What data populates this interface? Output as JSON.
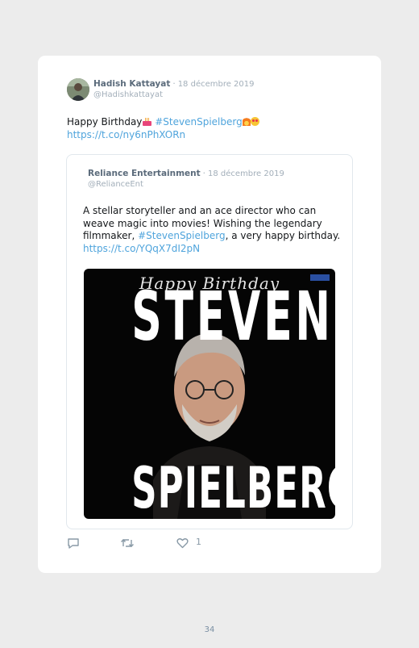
{
  "tweet": {
    "author_name": "Hadish Kattayat",
    "separator": "·",
    "date": "18 décembre 2019",
    "handle": "@Hadishkattayat",
    "text_prefix": "Happy Birthday",
    "hashtag": "#StevenSpielberg",
    "link": "https://t.co/ny6nPhXORn",
    "emojis": [
      "birthday-cake",
      "fire",
      "heart-eyes"
    ]
  },
  "quoted_tweet": {
    "author_name": "Reliance Entertainment",
    "separator": "·",
    "date": "18 décembre 2019",
    "handle": "@RelianceEnt",
    "text_part1": "A stellar storyteller and an ace director who can weave magic into movies! Wishing the legendary filmmaker, ",
    "hashtag": "#StevenSpielberg",
    "text_part2": ", a very happy birthday.",
    "link": "https://t.co/YQqX7dI2pN",
    "media": {
      "script_text": "Happy Birthday",
      "headline_top": "STEVEN",
      "headline_bottom": "SPIELBERG"
    }
  },
  "actions": {
    "reply_icon": "reply-icon",
    "retweet_icon": "retweet-icon",
    "like_icon": "heart-icon",
    "like_count": "1"
  },
  "page_number": "34",
  "colors": {
    "link": "#4fa4dc",
    "name": "#5b6b7b",
    "muted": "#a3afba",
    "background": "#ececec"
  }
}
